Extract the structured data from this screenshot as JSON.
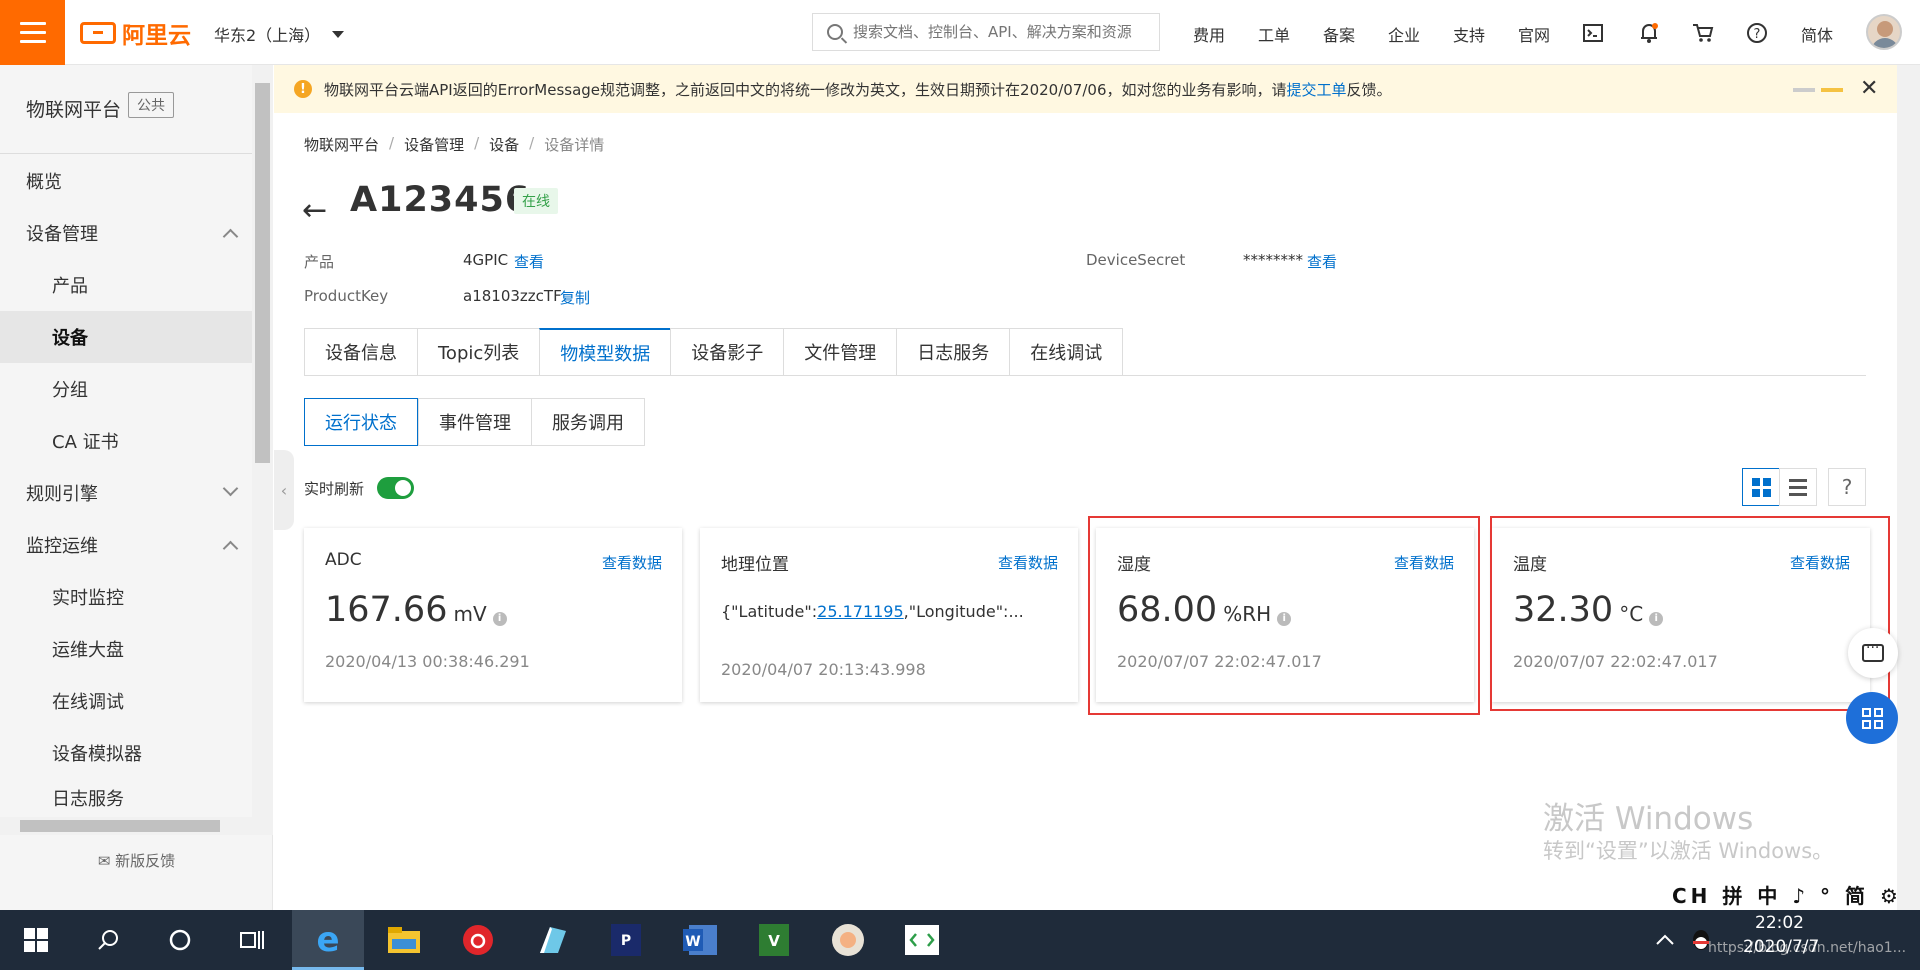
{
  "header": {
    "brand": "阿里云",
    "region": "华东2（上海）",
    "search_placeholder": "搜索文档、控制台、API、解决方案和资源",
    "nav": [
      "费用",
      "工单",
      "备案",
      "企业",
      "支持",
      "官网"
    ],
    "language": "简体"
  },
  "sidebar": {
    "title": "物联网平台",
    "tag": "公共",
    "items": [
      {
        "label": "概览"
      },
      {
        "label": "设备管理"
      },
      {
        "label": "产品"
      },
      {
        "label": "设备"
      },
      {
        "label": "分组"
      },
      {
        "label": "CA 证书"
      },
      {
        "label": "规则引擎"
      },
      {
        "label": "监控运维"
      },
      {
        "label": "实时监控"
      },
      {
        "label": "运维大盘"
      },
      {
        "label": "在线调试"
      },
      {
        "label": "设备模拟器"
      },
      {
        "label": "日志服务"
      }
    ],
    "feedback": "新版反馈"
  },
  "notice": {
    "text": "物联网平台云端API返回的ErrorMessage规范调整，之前返回中文的将统一修改为英文，生效日期预计在2020/07/06，如对您的业务有影响，请",
    "link": "提交工单",
    "suffix": "反馈。"
  },
  "breadcrumb": [
    "物联网平台",
    "设备管理",
    "设备",
    "设备详情"
  ],
  "device": {
    "name": "A123456",
    "status": "在线",
    "product_label": "产品",
    "product_value": "4GPIC",
    "view_link": "查看",
    "productkey_label": "ProductKey",
    "productkey_value": "a18103zzcTF",
    "copy_link": "复制",
    "secret_label": "DeviceSecret",
    "secret_value": "********",
    "secret_link": "查看"
  },
  "tabs": [
    "设备信息",
    "Topic列表",
    "物模型数据",
    "设备影子",
    "文件管理",
    "日志服务",
    "在线调试"
  ],
  "subtabs": [
    "运行状态",
    "事件管理",
    "服务调用"
  ],
  "refresh": {
    "label": "实时刷新",
    "on": true
  },
  "cards": [
    {
      "title": "ADC",
      "link": "查看数据",
      "value": "167.66",
      "unit": "mV",
      "time": "2020/04/13 00:38:46.291"
    },
    {
      "title": "地理位置",
      "link": "查看数据",
      "text_prefix": "{\"Latitude\":",
      "text_link": "25.171195",
      "text_suffix": ",\"Longitude\":...",
      "time": "2020/04/07 20:13:43.998"
    },
    {
      "title": "湿度",
      "link": "查看数据",
      "value": "68.00",
      "unit": "%RH",
      "time": "2020/07/07 22:02:47.017"
    },
    {
      "title": "温度",
      "link": "查看数据",
      "value": "32.30",
      "unit": "°C",
      "time": "2020/07/07 22:02:47.017"
    }
  ],
  "watermark": {
    "line1": "激活 Windows",
    "line2": "转到“设置”以激活 Windows。"
  },
  "ime": "CH 拼 中 ♪ ° 简 ⚙ :",
  "taskbar": {
    "time": "22:02",
    "date": "2020/7/7",
    "url": "https://blog.csdn.net/hao1..."
  },
  "colors": {
    "accent": "#ff6a00",
    "link": "#0070cc",
    "online": "#35a14a",
    "highlight": "#e53935"
  }
}
